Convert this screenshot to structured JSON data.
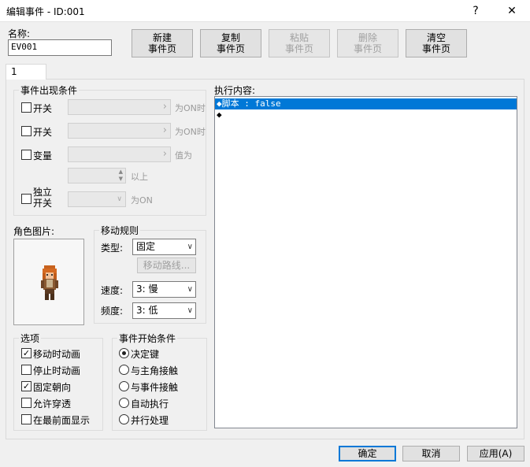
{
  "window": {
    "title": "编辑事件 - ID:001",
    "help_glyph": "?",
    "close_glyph": "✕"
  },
  "name": {
    "label": "名称:",
    "value": "EV001"
  },
  "toolbar": {
    "new_page": [
      "新建",
      "事件页"
    ],
    "copy_page": [
      "复制",
      "事件页"
    ],
    "paste_page": [
      "粘贴",
      "事件页"
    ],
    "delete_page": [
      "删除",
      "事件页"
    ],
    "clear_page": [
      "清空",
      "事件页"
    ]
  },
  "tabs": [
    {
      "label": "1"
    }
  ],
  "conditions": {
    "title": "事件出现条件",
    "switch1": {
      "label": "开关",
      "suffix": "为ON时"
    },
    "switch2": {
      "label": "开关",
      "suffix": "为ON时"
    },
    "variable": {
      "label": "变量",
      "suffix": "值为",
      "above": "以上"
    },
    "self_switch": {
      "label_line1": "独立",
      "label_line2": "开关",
      "suffix": "为ON"
    }
  },
  "image": {
    "label": "角色图片:"
  },
  "movement": {
    "title": "移动规则",
    "type_label": "类型:",
    "type_value": "固定",
    "route_button": "移动路线...",
    "speed_label": "速度:",
    "speed_value": "3: 慢",
    "freq_label": "频度:",
    "freq_value": "3: 低"
  },
  "options": {
    "title": "选项",
    "items": [
      {
        "label": "移动时动画",
        "checked": true
      },
      {
        "label": "停止时动画",
        "checked": false
      },
      {
        "label": "固定朝向",
        "checked": true
      },
      {
        "label": "允许穿透",
        "checked": false
      },
      {
        "label": "在最前面显示",
        "checked": false
      }
    ]
  },
  "trigger": {
    "title": "事件开始条件",
    "items": [
      {
        "label": "决定键",
        "selected": true
      },
      {
        "label": "与主角接触",
        "selected": false
      },
      {
        "label": "与事件接触",
        "selected": false
      },
      {
        "label": "自动执行",
        "selected": false
      },
      {
        "label": "并行处理",
        "selected": false
      }
    ]
  },
  "contents": {
    "label": "执行内容:",
    "lines": [
      "◆脚本 : false",
      "◆"
    ]
  },
  "footer": {
    "ok": "确定",
    "cancel": "取消",
    "apply": "应用(A)"
  },
  "colors": {
    "accent": "#0078d7"
  }
}
